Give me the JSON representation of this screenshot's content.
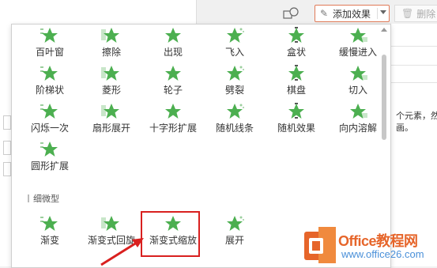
{
  "toolbar": {
    "add_effect_label": "添加效果",
    "delete_label": "删除"
  },
  "panel_snippets": [
    "个元素，然后",
    "画。"
  ],
  "effects": [
    {
      "label": "百叶窗",
      "icon": "blinds-star-icon"
    },
    {
      "label": "擦除",
      "icon": "wipe-star-icon"
    },
    {
      "label": "出现",
      "icon": "appear-star-icon"
    },
    {
      "label": "飞入",
      "icon": "fly-in-star-icon"
    },
    {
      "label": "盒状",
      "icon": "box-star-icon"
    },
    {
      "label": "缓慢进入",
      "icon": "crawl-in-star-icon"
    },
    {
      "label": "阶梯状",
      "icon": "steps-star-icon"
    },
    {
      "label": "菱形",
      "icon": "diamond-star-icon"
    },
    {
      "label": "轮子",
      "icon": "wheel-star-icon"
    },
    {
      "label": "劈裂",
      "icon": "split-star-icon"
    },
    {
      "label": "棋盘",
      "icon": "checkerboard-star-icon"
    },
    {
      "label": "切入",
      "icon": "peek-in-star-icon"
    },
    {
      "label": "闪烁一次",
      "icon": "flash-once-star-icon"
    },
    {
      "label": "扇形展开",
      "icon": "fan-star-icon"
    },
    {
      "label": "十字形扩展",
      "icon": "plus-star-icon"
    },
    {
      "label": "随机线条",
      "icon": "random-bars-star-icon"
    },
    {
      "label": "随机效果",
      "icon": "random-effects-star-icon"
    },
    {
      "label": "向内溶解",
      "icon": "dissolve-in-star-icon"
    },
    {
      "label": "圆形扩展",
      "icon": "circle-star-icon"
    }
  ],
  "subtle_section": {
    "title": "细微型",
    "effects": [
      {
        "label": "渐变",
        "icon": "fade-star-icon"
      },
      {
        "label": "渐变式回旋",
        "icon": "faded-swivel-star-icon"
      },
      {
        "label": "渐变式缩放",
        "icon": "faded-zoom-star-icon"
      },
      {
        "label": "展开",
        "icon": "expand-star-icon"
      }
    ]
  },
  "watermark": {
    "text": "Office教程网",
    "url": "www.office26.com"
  },
  "colors": {
    "star_green": "#4caf50",
    "highlight_red": "#d9201f",
    "button_border": "#e07a58",
    "watermark_orange": "#e6652a"
  }
}
